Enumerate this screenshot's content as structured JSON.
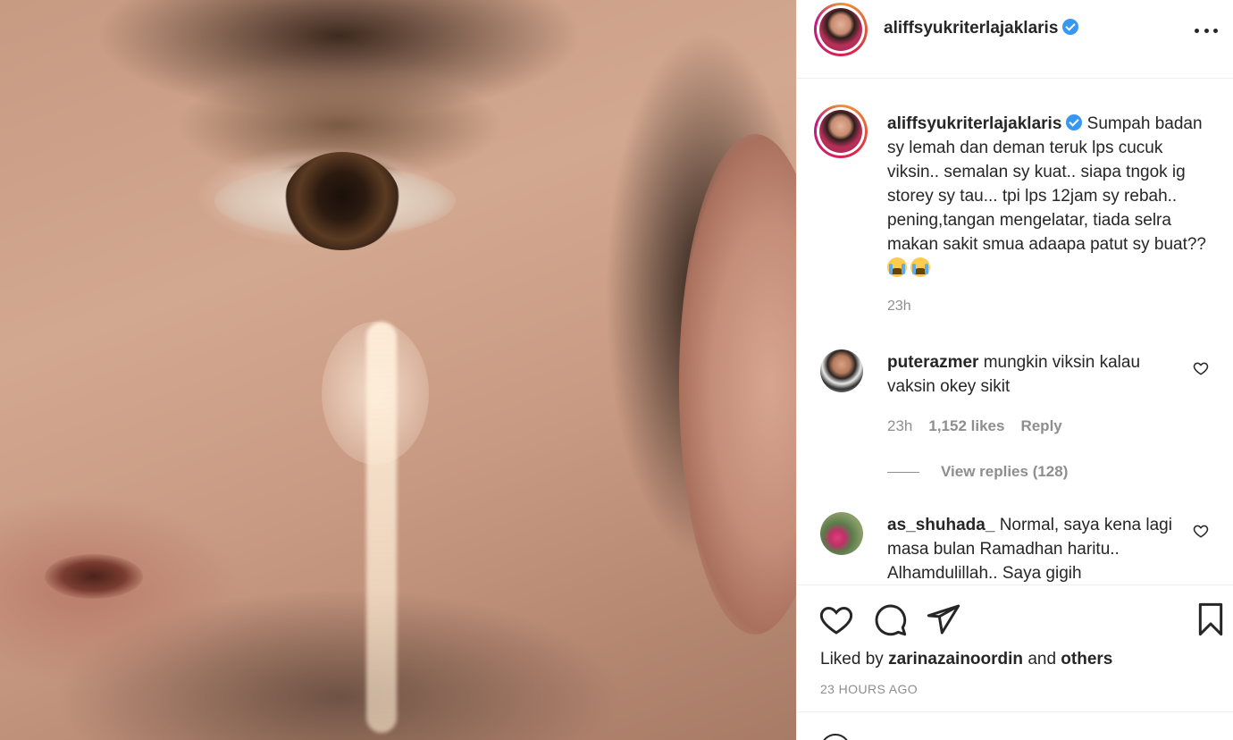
{
  "post": {
    "username": "aliffsyukriterlajaklaris"
  },
  "caption": {
    "username": "aliffsyukriterlajaklaris",
    "text": "Sumpah badan sy lemah dan deman teruk lps cucuk viksin.. semalan sy kuat.. siapa tngok ig storey sy tau... tpi lps 12jam sy rebah.. pening,tangan mengelatar, tiada selra makan sakit smua adaapa patut sy buat??",
    "emojis": [
      "loudly-crying-face-emoji",
      "loudly-crying-face-emoji"
    ],
    "time": "23h"
  },
  "comments": [
    {
      "username": "puterazmer",
      "text": "mungkin viksin kalau vaksin okey sikit",
      "time": "23h",
      "likes": "1,152 likes",
      "reply_label": "Reply",
      "view_replies": "View replies (128)"
    },
    {
      "username": "as_shuhada_",
      "text": "Normal, saya kena lagi masa bulan Ramadhan haritu.. Alhamdulillah.. Saya gigih"
    }
  ],
  "likes": {
    "prefix": "Liked by",
    "user": "zarinazainoordin",
    "connector": "and",
    "others": "others"
  },
  "timestamp": "23 HOURS AGO",
  "icons": [
    "more-icon",
    "heart-icon",
    "comment-icon",
    "share-icon",
    "bookmark-icon",
    "verified-badge-icon",
    "emoji-icon"
  ],
  "colors": {
    "verified": "#3897f0",
    "muted_text": "#8e8e8e",
    "text": "#262626"
  }
}
